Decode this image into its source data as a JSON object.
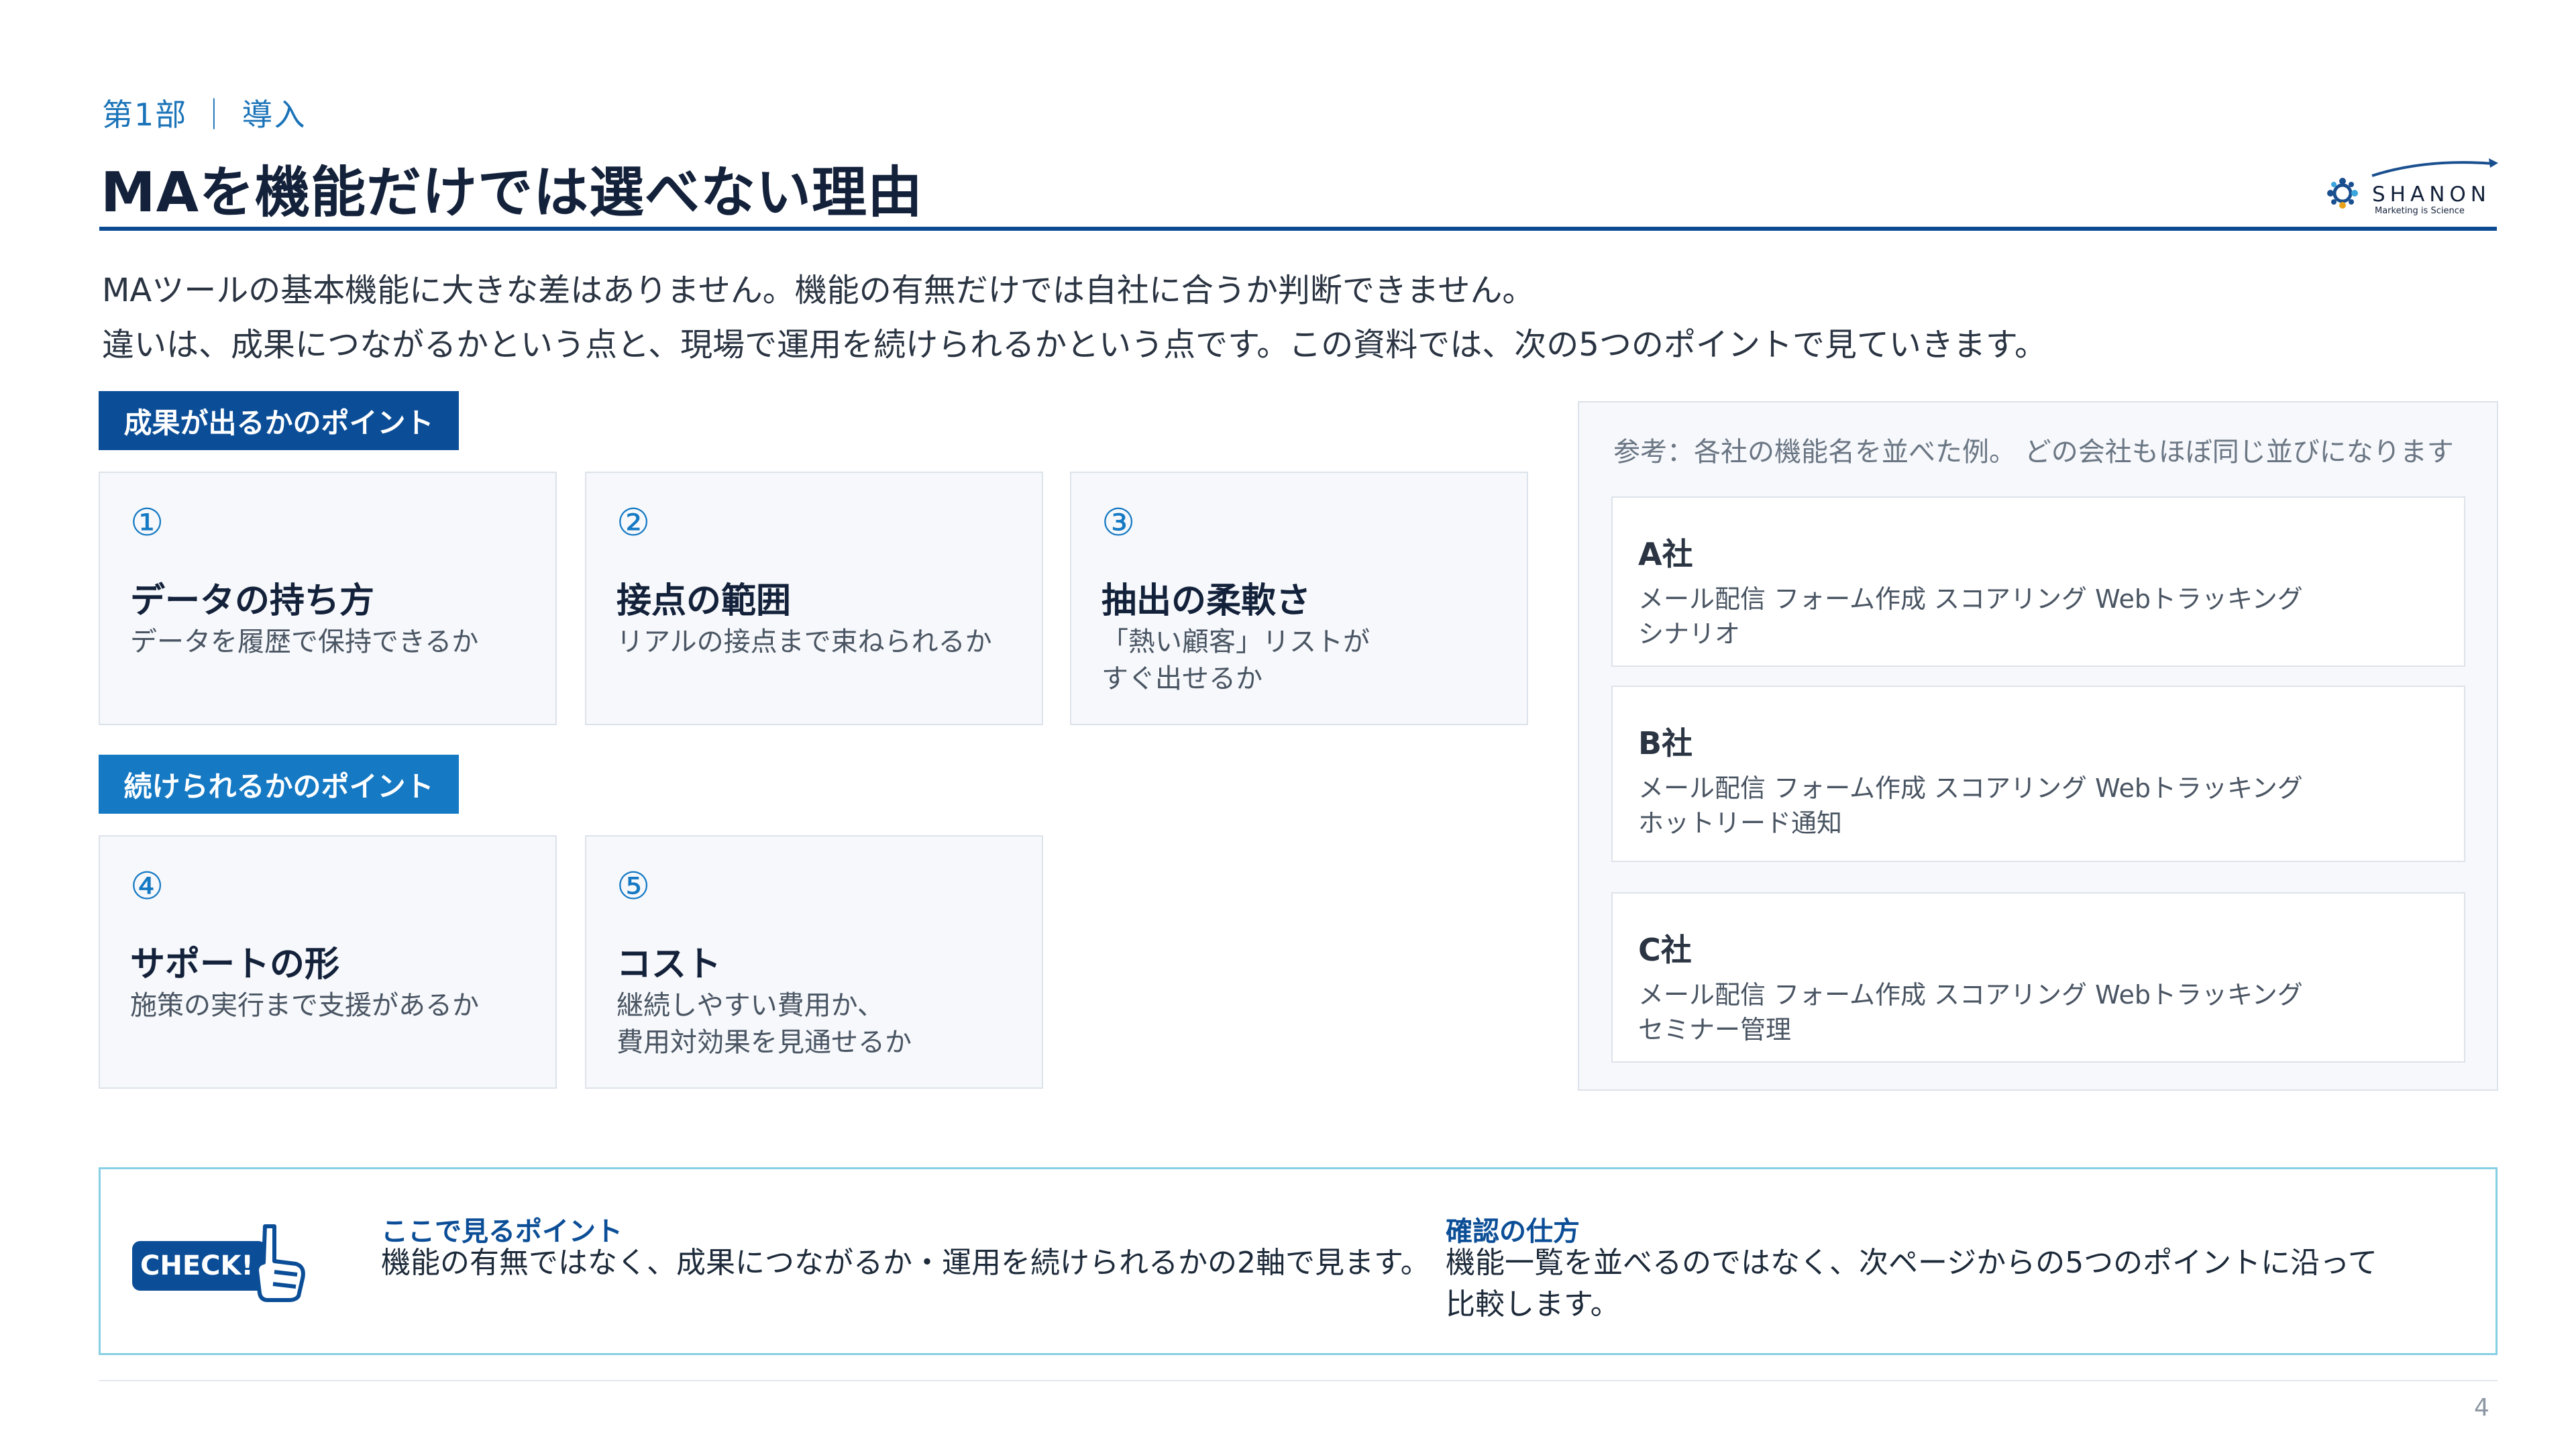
{
  "header": {
    "section_label": "第1部 ｜ 導入",
    "title": "MAを機能だけでは選べない理由",
    "logo_text": "SHANON",
    "logo_tagline": "Marketing is Science"
  },
  "intro": {
    "line1": "MAツールの基本機能に大きな差はありません。機能の有無だけでは自社に合うか判断できません。",
    "line2": "違いは、成果につながるかという点と、現場で運用を続けられるかという点です。この資料では、次の5つのポイントで見ていきます。"
  },
  "groups": [
    {
      "label": "成果が出るかのポイント",
      "points": [
        {
          "num": "①",
          "title": "データの持ち方",
          "desc": [
            "データを履歴で保持できるか"
          ]
        },
        {
          "num": "②",
          "title": "接点の範囲",
          "desc": [
            "リアルの接点まで束ねられるか"
          ]
        },
        {
          "num": "③",
          "title": "抽出の柔軟さ",
          "desc": [
            "「熱い顧客」リストが",
            "すぐ出せるか"
          ]
        }
      ]
    },
    {
      "label": "続けられるかのポイント",
      "points": [
        {
          "num": "④",
          "title": "サポートの形",
          "desc": [
            "施策の実行まで支援があるか"
          ]
        },
        {
          "num": "⑤",
          "title": "コスト",
          "desc": [
            "継続しやすい費用か、",
            "費用対効果を見通せるか"
          ]
        }
      ]
    }
  ],
  "reference": {
    "heading": "参考：各社の機能名を並べた例。 どの会社もほぼ同じ並びになります",
    "companies": [
      {
        "name": "A社",
        "line1": "メール配信 フォーム作成 スコアリング Webトラッキング",
        "line2": "シナリオ"
      },
      {
        "name": "B社",
        "line1": "メール配信 フォーム作成 スコアリング Webトラッキング",
        "line2": "ホットリード通知"
      },
      {
        "name": "C社",
        "line1": "メール配信 フォーム作成 スコアリング Webトラッキング",
        "line2": "セミナー管理"
      }
    ]
  },
  "check": {
    "badge_text": "CHECK!",
    "point_heading": "ここで見るポイント",
    "point_text": "機能の有無ではなく、成果につながるか・運用を続けられるかの2軸で見ます。",
    "method_heading": "確認の仕方",
    "method_line1": "機能一覧を並べるのではなく、次ページからの5つのポイントに沿って",
    "method_line2": "比較します。"
  },
  "footer": {
    "page_number": "4"
  },
  "colors": {
    "primary": "#0b4e97",
    "accent": "#1579c4",
    "title": "#13213a",
    "check_border": "#86cfe4"
  }
}
